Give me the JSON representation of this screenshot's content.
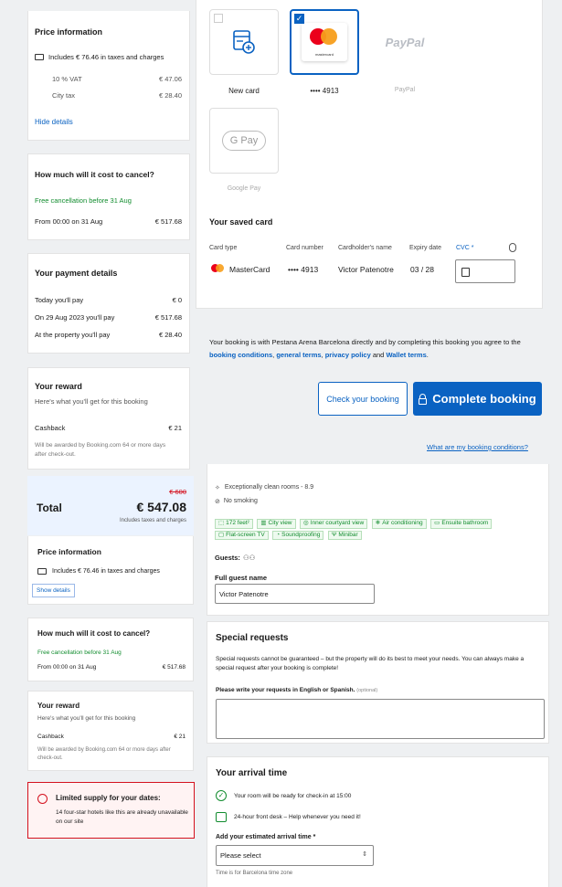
{
  "left_top": {
    "price_info": {
      "title": "Price information",
      "includes": "Includes € 76.46 in taxes and charges",
      "rows": [
        {
          "label": "10 % VAT",
          "value": "€ 47.06"
        },
        {
          "label": "City tax",
          "value": "€ 28.40"
        }
      ],
      "link": "Hide details"
    },
    "cancel": {
      "title": "How much will it cost to cancel?",
      "free": "Free cancellation before 31 Aug",
      "from_label": "From 00:00 on 31 Aug",
      "from_value": "€ 517.68"
    },
    "payment": {
      "title": "Your payment details",
      "rows": [
        {
          "label": "Today you'll pay",
          "value": "€ 0"
        },
        {
          "label": "On 29 Aug 2023 you'll pay",
          "value": "€ 517.68"
        },
        {
          "label": "At the property you'll pay",
          "value": "€ 28.40"
        }
      ]
    },
    "reward": {
      "title": "Your reward",
      "subtitle": "Here's what you'll get for this booking",
      "label": "Cashback",
      "value": "€ 21",
      "note": "Will be awarded by Booking.com 64 or more days after check-out."
    }
  },
  "right_top": {
    "methods": [
      {
        "name": "New card",
        "selected": false
      },
      {
        "name": "•••• 4913",
        "selected": true
      },
      {
        "name": "PayPal",
        "selected": false
      },
      {
        "name": "Google Pay",
        "selected": false
      }
    ],
    "paypal_logo": "PayPal",
    "gpay_logo": "G Pay",
    "mastercard_small": "mastercard",
    "saved_card": {
      "title": "Your saved card",
      "headers": [
        "Card type",
        "Card number",
        "Cardholder's name",
        "Expiry date",
        "CVC *"
      ],
      "type": "MasterCard",
      "number": "•••• 4913",
      "holder": "Victor Patenotre",
      "expiry": "03 / 28"
    },
    "terms": {
      "text_before": "Your booking is with Pestana Arena Barcelona directly and by completing this booking you agree to the",
      "link1": "booking conditions",
      "link2": "general terms",
      "link3": "privacy policy",
      "and": "and",
      "link4": "Wallet terms"
    },
    "check_button": "Check your booking",
    "complete_button": "Complete booking",
    "conditions_link": "What are my booking conditions?"
  },
  "left_bottom": {
    "total": {
      "old": "€ 600",
      "label": "Total",
      "value": "€ 547.08",
      "note": "Includes taxes and charges"
    },
    "price_info": {
      "title": "Price information",
      "includes": "Includes € 76.46 in taxes and charges",
      "link": "Show details"
    },
    "cancel": {
      "title": "How much will it cost to cancel?",
      "free": "Free cancellation before 31 Aug",
      "from_label": "From 00:00 on 31 Aug",
      "from_value": "€ 517.68"
    },
    "reward": {
      "title": "Your reward",
      "subtitle": "Here's what you'll get for this booking",
      "label": "Cashback",
      "value": "€ 21",
      "note": "Will be awarded by Booking.com 64 or more days after check-out."
    },
    "alert": {
      "title": "Limited supply for your dates:",
      "text": "14 four-star hotels like this are already unavailable on our site"
    }
  },
  "right_bottom": {
    "room": {
      "clean": "Exceptionally clean rooms - 8.9",
      "smoking": "No smoking",
      "amenities": [
        "172 feet²",
        "City view",
        "Inner courtyard view",
        "Air conditioning",
        "Ensuite bathroom",
        "Flat-screen TV",
        "Soundproofing",
        "Minibar"
      ],
      "guests_label": "Guests:",
      "name_label": "Full guest name",
      "name_value": "Victor Patenotre"
    },
    "requests": {
      "title": "Special requests",
      "text": "Special requests cannot be guaranteed – but the property will do its best to meet your needs. You can always make a special request after your booking is complete!",
      "prompt": "Please write your requests in English or Spanish.",
      "optional": "(optional)"
    },
    "arrival": {
      "title": "Your arrival time",
      "ready": "Your room will be ready for check-in at 15:00",
      "desk": "24-hour front desk – Help whenever you need it!",
      "select_label": "Add your estimated arrival time *",
      "select_value": "Please select",
      "tz": "Time is for Barcelona time zone"
    }
  },
  "colors": {
    "accent": "#0a62c2",
    "green": "#118c2e",
    "alert": "#d4111e",
    "total_bg": "#ebf3ff"
  }
}
